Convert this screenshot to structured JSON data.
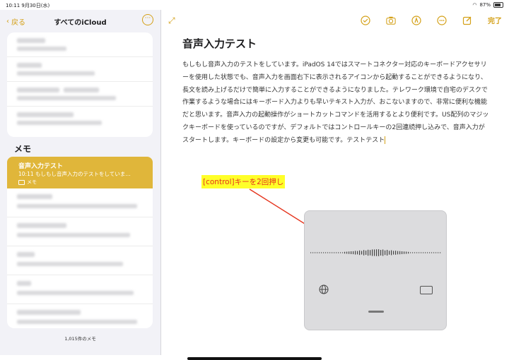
{
  "status": {
    "time": "10:11  9月30日(水)",
    "battery": "87%"
  },
  "sidebar": {
    "back_label": "戻る",
    "title": "すべてのiCloud",
    "section_label": "メモ",
    "selected_note": {
      "title": "音声入力テスト",
      "time": "10:11",
      "preview": "もしもし音声入力のテストをしていま…",
      "folder": "メモ"
    },
    "footer_count": "1,015件のメモ"
  },
  "toolbar": {
    "done_label": "完了"
  },
  "note": {
    "title": "音声入力テスト",
    "body": "もしもし音声入力のテストをしています。iPadOS 14ではスマートコネクター対応のキーボードアクセサリーを使用した状態でも、音声入力を画面右下に表示されるアイコンから起動することができるようになり、長文を読み上げるだけで簡単に入力することができるようになりました。テレワーク環境で自宅のデスクで作業するような場合にはキーボード入力よりも早いテキスト入力が、おこないますので、非常に便利な機能だと思います。音声入力の起動操作がショートカットコマンドを活用するとより便利です。US配列のマジックキーボードを使っているのですが、デフォルトではコントロールキーの2回連続押し込みで、音声入力がスタートします。キーボードの設定から変更も可能です。テストテスト"
  },
  "annotation": {
    "text": "[control]キーを2回押し"
  },
  "colors": {
    "accent": "#d4a017",
    "selected": "#e0b63a",
    "annotation_bg": "#ffff29",
    "annotation_text": "#e5331c"
  }
}
